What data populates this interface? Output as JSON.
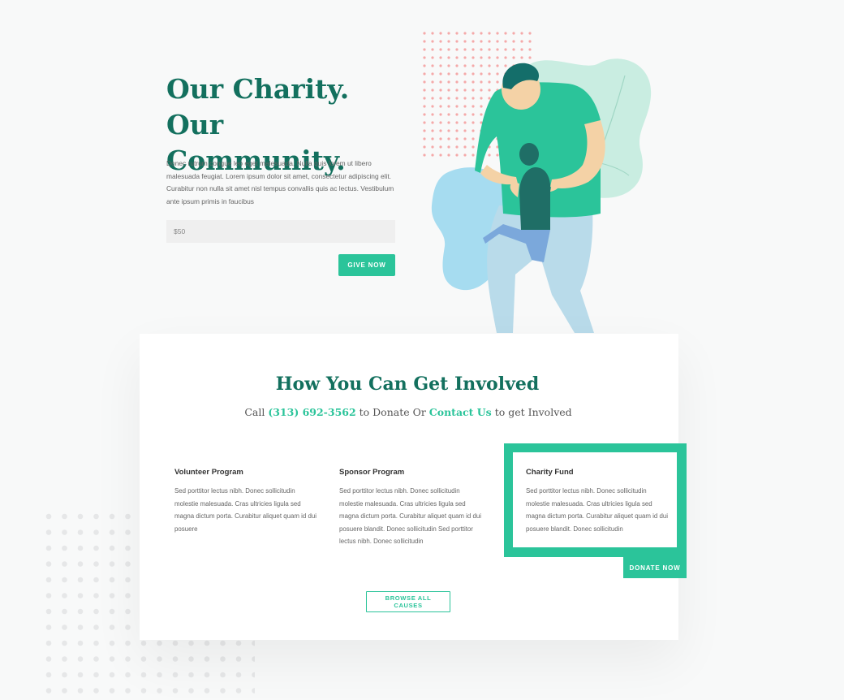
{
  "hero": {
    "title": "Our Charity. Our Community.",
    "text": "Donec rutrum congue leo eget malesuada. Nulla quis lorem ut libero malesuada feugiat. Lorem ipsum dolor sit amet, consectetur adipiscing elit. Curabitur non nulla sit amet nisl tempus convallis quis ac lectus.  Vestibulum ante ipsum primis in faucibus",
    "amount_placeholder": "$50",
    "give_label": "GIVE NOW"
  },
  "involved": {
    "title": "How You Can Get Involved",
    "sub_call": "Call ",
    "phone": "(313) 692-3562",
    "sub_mid": " to Donate Or ",
    "contact_link": "Contact Us",
    "sub_end": " to get Involved",
    "programs": [
      {
        "title": "Volunteer Program",
        "text": "Sed porttitor lectus nibh. Donec sollicitudin molestie malesuada. Cras ultricies ligula sed magna dictum porta. Curabitur aliquet quam id dui posuere"
      },
      {
        "title": "Sponsor Program",
        "text": "Sed porttitor lectus nibh. Donec sollicitudin molestie malesuada. Cras ultricies ligula sed magna dictum porta. Curabitur aliquet quam id dui posuere blandit. Donec sollicitudin Sed porttitor lectus nibh. Donec sollicitudin"
      },
      {
        "title": "Charity Fund",
        "text": "Sed porttitor lectus nibh. Donec sollicitudin molestie malesuada. Cras ultricies ligula sed magna dictum porta. Curabitur aliquet quam id dui posuere blandit. Donec sollicitudin"
      }
    ],
    "donate_label": "DONATE NOW",
    "browse_label": "BROWSE ALL CAUSES"
  },
  "colors": {
    "primary_dark": "#13705e",
    "accent": "#2bc49a",
    "background": "#f8f9f9"
  },
  "icons": {
    "illustration": "parent-lifting-child-illustration"
  }
}
